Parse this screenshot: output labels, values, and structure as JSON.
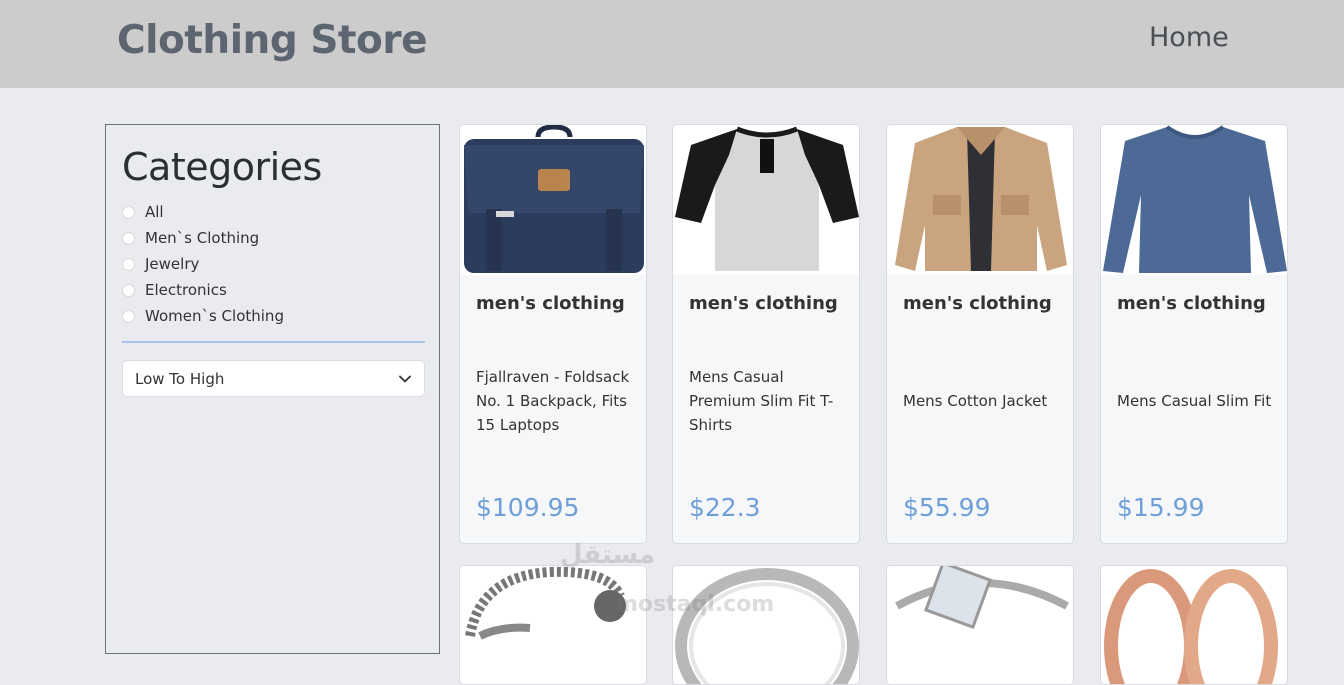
{
  "navbar": {
    "brand": "Clothing Store",
    "home_label": "Home"
  },
  "sidebar": {
    "heading": "Categories",
    "categories": [
      "All",
      "Men`s Clothing",
      "Jewelry",
      "Electronics",
      "Women`s Clothing"
    ],
    "sort_selected": "Low To High"
  },
  "products": [
    {
      "category": "men's clothing",
      "title": "Fjallraven - Foldsack No. 1 Backpack, Fits 15 Laptops",
      "price": "$109.95",
      "image": "backpack"
    },
    {
      "category": "men's clothing",
      "title": "Mens Casual Premium Slim Fit T-Shirts",
      "price": "$22.3",
      "image": "raglan-tshirt"
    },
    {
      "category": "men's clothing",
      "title": "Mens Cotton Jacket",
      "price": "$55.99",
      "image": "cotton-jacket"
    },
    {
      "category": "men's clothing",
      "title": "Mens Casual Slim Fit",
      "price": "$15.99",
      "image": "long-sleeve-shirt"
    }
  ],
  "row2_images": [
    "chain-bracelet",
    "silver-ring",
    "diamond-ring",
    "rose-gold-rings"
  ],
  "watermark": {
    "arabic": "مستقل",
    "latin": "mostaql.com"
  },
  "colors": {
    "navbar_bg": "#cccccc",
    "page_bg": "#e9ebee",
    "price": "#6f9fd8",
    "divider": "#a9c4ea"
  }
}
